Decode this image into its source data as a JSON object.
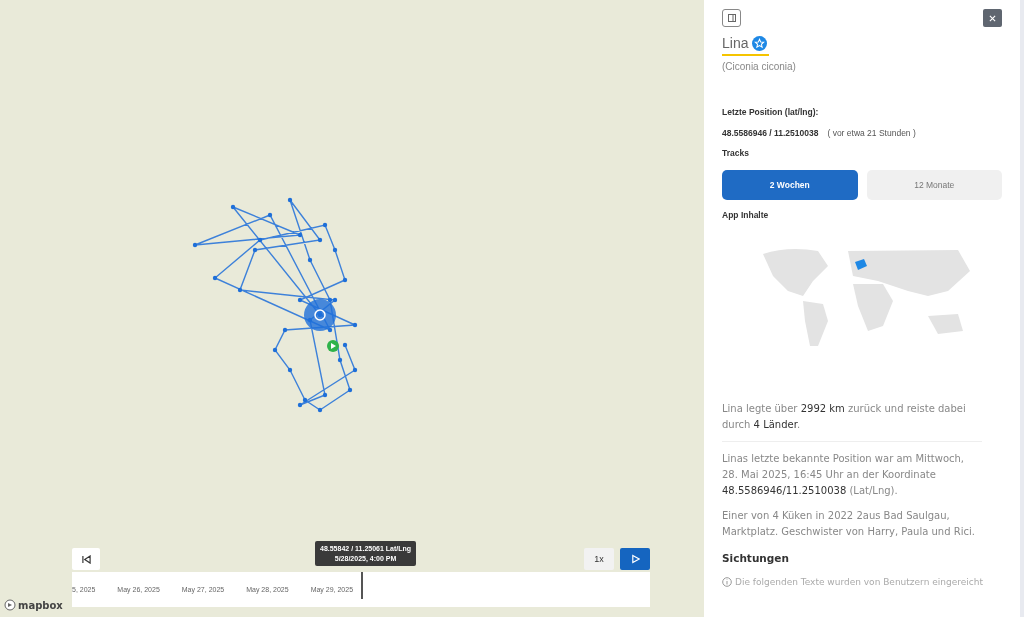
{
  "map": {
    "attribution": "mapbox",
    "tooltip": {
      "coords": "48.55842 / 11.25061 Lat/Lng",
      "time": "5/28/2025, 4:00 PM"
    },
    "timeline": {
      "labels": [
        "5, 2025",
        "May 26, 2025",
        "May 27, 2025",
        "May 28, 2025",
        "May 29, 2025"
      ],
      "level": 0.5
    },
    "speed_button": "1x",
    "playing": false
  },
  "panel": {
    "name": "Lina",
    "favorite": true,
    "species": "(Ciconia ciconia)",
    "position_label": "Letzte Position (lat/lng):",
    "position": "48.5586946 / 11.2510038",
    "position_age": "( vor etwa 21 Stunden )",
    "tracks_label": "Tracks",
    "tracks": [
      {
        "label": "2 Wochen",
        "selected": true
      },
      {
        "label": "12 Monate",
        "selected": false
      }
    ],
    "app_label": "App Inhalte",
    "summary": "Lina legte über **2992 km** zurück und reiste dabei durch **4 Länder**.",
    "paragraphs": [
      "Linas letzte bekannte Position war am Mittwoch, 28. Mai 2025, 16:45 Uhr an der Koordinate **48.5586946/11.2510038** (Lat/Lng).",
      "Einer von 4 Küken in 2022 2aus Bad Saulgau, Marktplatz. Geschwister von Harry, Paula und Rici."
    ],
    "sightings_title": "Sichtungen",
    "sightings_note": "Die folgenden Texte wurden von Benutzern eingereicht"
  }
}
